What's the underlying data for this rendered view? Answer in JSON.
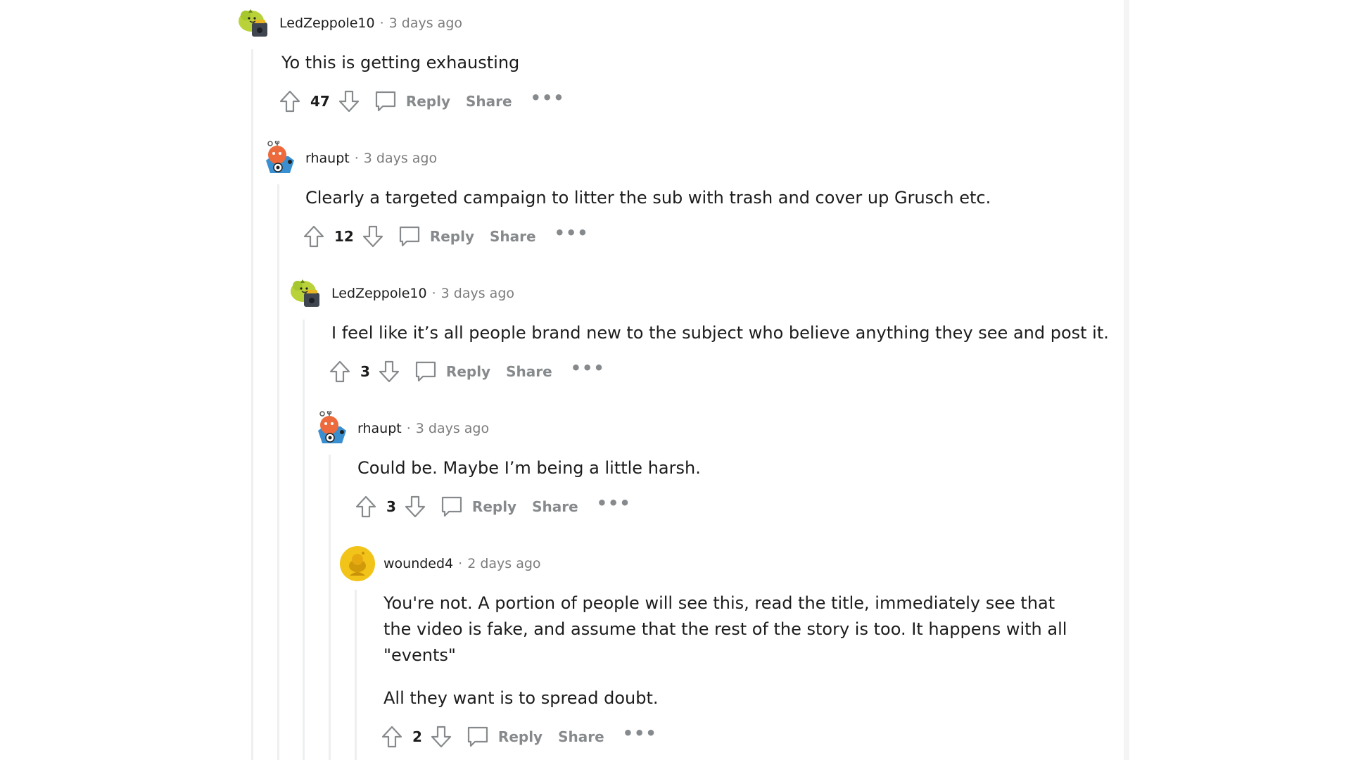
{
  "comments": [
    {
      "user": "LedZeppole10",
      "separator": "·",
      "time": "3 days ago",
      "paragraphs": [
        "Yo this is getting exhausting"
      ],
      "score": "47",
      "reply_label": "Reply",
      "share_label": "Share",
      "more_label": "•••",
      "avatar": "green-snoo-avatar"
    },
    {
      "user": "rhaupt",
      "separator": "·",
      "time": "3 days ago",
      "paragraphs": [
        "Clearly a targeted campaign to litter the sub with trash and cover up Grusch etc."
      ],
      "score": "12",
      "reply_label": "Reply",
      "share_label": "Share",
      "more_label": "•••",
      "avatar": "orange-robot-avatar"
    },
    {
      "user": "LedZeppole10",
      "separator": "·",
      "time": "3 days ago",
      "paragraphs": [
        "I feel like it’s all people brand new to the subject who believe anything they see and post it."
      ],
      "score": "3",
      "reply_label": "Reply",
      "share_label": "Share",
      "more_label": "•••",
      "avatar": "green-snoo-avatar"
    },
    {
      "user": "rhaupt",
      "separator": "·",
      "time": "3 days ago",
      "paragraphs": [
        "Could be. Maybe I’m being a little harsh."
      ],
      "score": "3",
      "reply_label": "Reply",
      "share_label": "Share",
      "more_label": "•••",
      "avatar": "orange-robot-avatar"
    },
    {
      "user": "wounded4",
      "separator": "·",
      "time": "2 days ago",
      "paragraphs": [
        "You're not. A portion of people will see this, read the title, immediately see that the video is fake, and assume that the rest of the story is too. It happens with all \"events\"",
        "All they want is to spread doubt."
      ],
      "score": "2",
      "reply_label": "Reply",
      "share_label": "Share",
      "more_label": "•••",
      "avatar": "yellow-default-avatar"
    }
  ],
  "colors": {
    "text": "#1c1c1c",
    "meta": "#7c7c7c",
    "icon": "#878a8c",
    "rail": "#edeff1",
    "avatar_yellow": "#f2c318"
  }
}
